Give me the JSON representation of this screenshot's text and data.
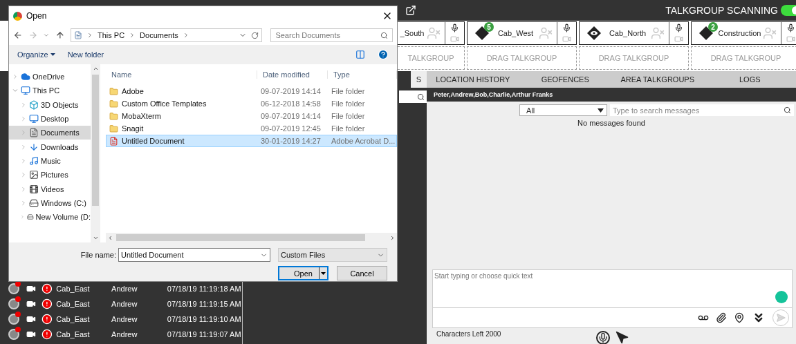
{
  "header": {
    "scanning": {
      "label": "TALKGROUP SCANNING",
      "on": true
    }
  },
  "talkgroups": [
    {
      "name": "_South",
      "kind": "partial"
    },
    {
      "name": "Cab_West",
      "kind": "tag",
      "badge": "5"
    },
    {
      "name": "Cab_North",
      "kind": "eye"
    },
    {
      "name": "Construction",
      "kind": "tag",
      "badge": "2"
    }
  ],
  "drag_slots": [
    "TALKGROUP",
    "DRAG TALKGROUP",
    "DRAG TALKGROUP",
    "DRAG TALKGROUP"
  ],
  "tabs": [
    {
      "label": "S",
      "selected": true
    },
    {
      "label": "LOCATION HISTORY",
      "selected": false
    },
    {
      "label": "GEOFENCES",
      "selected": false
    },
    {
      "label": "AREA TALKGROUPS",
      "selected": false
    },
    {
      "label": "LOGS",
      "selected": false
    }
  ],
  "conversation": {
    "members": "Peter,Andrew,Bob,Charlie,Arthur Franks",
    "filter": "All",
    "search_placeholder": "Type to search messages",
    "empty": "No messages found",
    "compose_placeholder": "Start typing or choose quick text",
    "characters_left": "Characters Left 2000"
  },
  "log_rows": [
    {
      "talkgroup": "Cab_East",
      "user": "Andrew",
      "time": "07/18/19 11:19:18 AM"
    },
    {
      "talkgroup": "Cab_East",
      "user": "Andrew",
      "time": "07/18/19 11:19:15 AM"
    },
    {
      "talkgroup": "Cab_East",
      "user": "Andrew",
      "time": "07/18/19 11:19:10 AM"
    },
    {
      "talkgroup": "Cab_East",
      "user": "Andrew",
      "time": "07/18/19 11:19:07 AM"
    }
  ],
  "dialog": {
    "title": "Open",
    "path": [
      "This PC",
      "Documents"
    ],
    "search_placeholder": "Search Documents",
    "organize": "Organize",
    "new_folder": "New folder",
    "nav": [
      {
        "label": "OneDrive",
        "kind": "cloud",
        "expanded": false,
        "selected": false
      },
      {
        "label": "This PC",
        "kind": "pc",
        "expanded": true,
        "selected": false,
        "children": [
          {
            "label": "3D Objects",
            "kind": "cube",
            "expanded": false,
            "selected": false
          },
          {
            "label": "Desktop",
            "kind": "desktop",
            "expanded": false,
            "selected": false
          },
          {
            "label": "Documents",
            "kind": "documents",
            "expanded": false,
            "selected": true
          },
          {
            "label": "Downloads",
            "kind": "downloads",
            "expanded": false,
            "selected": false
          },
          {
            "label": "Music",
            "kind": "music",
            "expanded": false,
            "selected": false
          },
          {
            "label": "Pictures",
            "kind": "pictures",
            "expanded": false,
            "selected": false
          },
          {
            "label": "Videos",
            "kind": "videos",
            "expanded": false,
            "selected": false
          },
          {
            "label": "Windows (C:)",
            "kind": "drive",
            "expanded": false,
            "selected": false
          },
          {
            "label": "New Volume (D:",
            "kind": "drive",
            "expanded": false,
            "selected": false
          }
        ]
      }
    ],
    "columns": [
      "Name",
      "Date modified",
      "Type"
    ],
    "files": [
      {
        "name": "Adobe",
        "date": "09-07-2019 14:14",
        "type": "File folder",
        "kind": "folder",
        "selected": false
      },
      {
        "name": "Custom Office Templates",
        "date": "06-12-2018 14:58",
        "type": "File folder",
        "kind": "folder",
        "selected": false
      },
      {
        "name": "MobaXterm",
        "date": "09-07-2019 14:14",
        "type": "File folder",
        "kind": "folder",
        "selected": false
      },
      {
        "name": "Snagit",
        "date": "09-07-2019 12:45",
        "type": "File folder",
        "kind": "folder",
        "selected": false
      },
      {
        "name": "Untitled Document",
        "date": "30-01-2019 14:27",
        "type": "Adobe Acrobat D...",
        "kind": "pdf",
        "selected": true
      }
    ],
    "file_name_label": "File name:",
    "file_name": "Untitled Document",
    "file_type": "Custom Files",
    "buttons": [
      "Open",
      "Cancel"
    ]
  }
}
